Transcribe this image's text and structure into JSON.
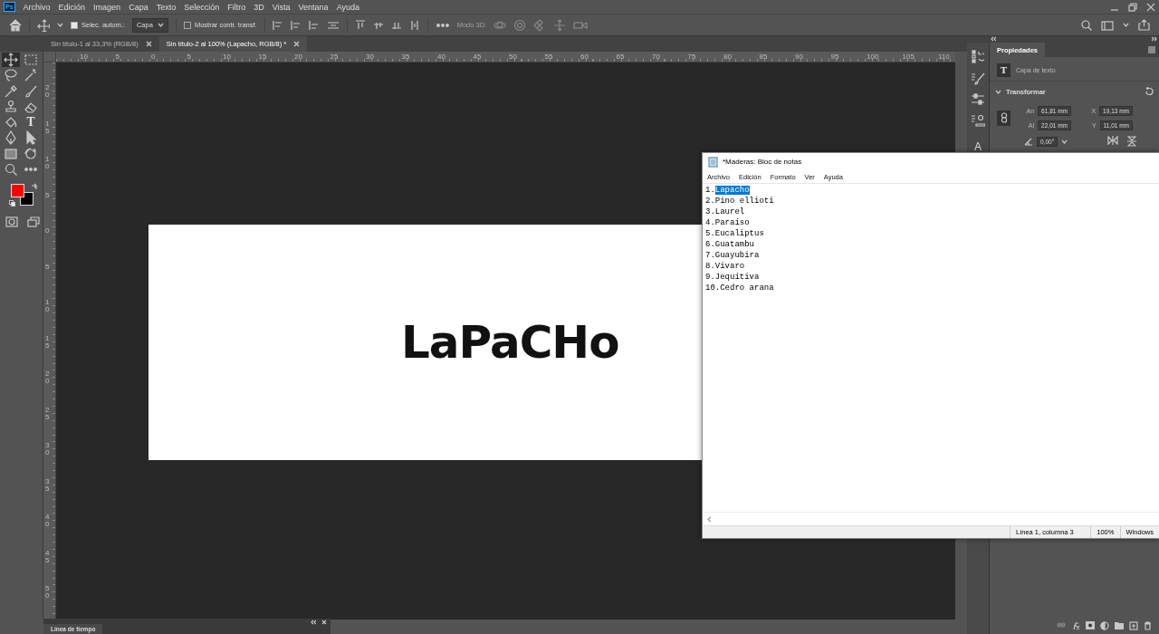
{
  "menubar": {
    "logo": "Ps",
    "items": [
      "Archivo",
      "Edición",
      "Imagen",
      "Capa",
      "Texto",
      "Selección",
      "Filtro",
      "3D",
      "Vista",
      "Ventana",
      "Ayuda"
    ]
  },
  "options_bar": {
    "auto_select": {
      "label": "Selec. autom.:",
      "checked": true
    },
    "target": "Capa",
    "show_transform": {
      "label": "Mostrar contr. transf.",
      "checked": false
    },
    "mode_3d": {
      "label": "Modo 3D:",
      "disabled": true
    }
  },
  "tabs": [
    {
      "label": "Sin título-1 al 33,3% (RGB/8)",
      "selected": false
    },
    {
      "label": "Sin título-2 al 100% (Lapacho, RGB/8) *",
      "selected": true
    }
  ],
  "tools": [
    {
      "kind": "move",
      "selected": true
    },
    {
      "kind": "marquee",
      "selected": false
    },
    {
      "kind": "lasso",
      "selected": false
    },
    {
      "kind": "wand",
      "selected": false
    },
    {
      "kind": "eyedropper",
      "selected": false
    },
    {
      "kind": "brush",
      "selected": false
    },
    {
      "kind": "stamp",
      "selected": false
    },
    {
      "kind": "eraser",
      "selected": false
    },
    {
      "kind": "bucket",
      "selected": false
    },
    {
      "kind": "type",
      "glyph": "T",
      "selected": false
    },
    {
      "kind": "pen",
      "selected": false
    },
    {
      "kind": "arrow",
      "selected": false
    },
    {
      "kind": "rectangle",
      "selected": false
    },
    {
      "kind": "rotate",
      "selected": false
    },
    {
      "kind": "zoom",
      "selected": false
    },
    {
      "kind": "more",
      "selected": false
    }
  ],
  "swatches": [
    {
      "kind": "foreground",
      "color": "#ff0000"
    },
    {
      "kind": "background",
      "color": "#000000"
    }
  ],
  "ruler_h": [
    "10",
    "5",
    "0",
    "5",
    "10",
    "15",
    "20",
    "25",
    "30",
    "35",
    "40",
    "45",
    "50",
    "55",
    "60",
    "65",
    "70",
    "75",
    "80",
    "85",
    "90",
    "95",
    "100",
    "105",
    "110"
  ],
  "ruler_v": [
    "20",
    "15",
    "10",
    "5",
    "0",
    "5",
    "10",
    "15",
    "20",
    "25",
    "30",
    "35",
    "40",
    "45",
    "50"
  ],
  "document": {
    "text": "LaPaCHo"
  },
  "panel_strip": [
    {
      "kind": "history"
    },
    {
      "kind": "brushes"
    },
    {
      "kind": "sliders"
    },
    {
      "kind": "stamps"
    },
    {
      "kind": "character",
      "glyph": "A"
    }
  ],
  "properties": {
    "tab": "Propiedades",
    "layer_glyph": "T",
    "layer_kind": "Capa de texto",
    "section": {
      "title": "Transformar",
      "expanded": true
    },
    "fields": [
      {
        "label": "An",
        "value": "61,81 mm"
      },
      {
        "label": "X",
        "value": "19,13 mm"
      },
      {
        "label": "Al",
        "value": "22,01 mm"
      },
      {
        "label": "Y",
        "value": "11,01 mm"
      }
    ],
    "angle": "0,00°"
  },
  "timeline": {
    "tab": "Línea de tiempo"
  },
  "notepad": {
    "title": "*Maderas: Bloc de notas",
    "menu": [
      "Archivo",
      "Edición",
      "Formato",
      "Ver",
      "Ayuda"
    ],
    "lines": [
      {
        "number": "1.",
        "text": "Lapacho",
        "selected": true
      },
      {
        "number": "2.",
        "text": "Pino ellioti",
        "selected": false
      },
      {
        "number": "3.",
        "text": "Laurel",
        "selected": false
      },
      {
        "number": "4.",
        "text": "Paraiso",
        "selected": false
      },
      {
        "number": "5.",
        "text": "Eucaliptus",
        "selected": false
      },
      {
        "number": "6.",
        "text": "Guatambu",
        "selected": false
      },
      {
        "number": "7.",
        "text": "Guayubira",
        "selected": false
      },
      {
        "number": "8.",
        "text": "Vivaro",
        "selected": false
      },
      {
        "number": "9.",
        "text": "Jequitiva",
        "selected": false
      },
      {
        "number": "10.",
        "text": "Cedro arana",
        "selected": false
      }
    ],
    "status": [
      "Línea 1, columna 3",
      "100%",
      "Windows"
    ]
  }
}
